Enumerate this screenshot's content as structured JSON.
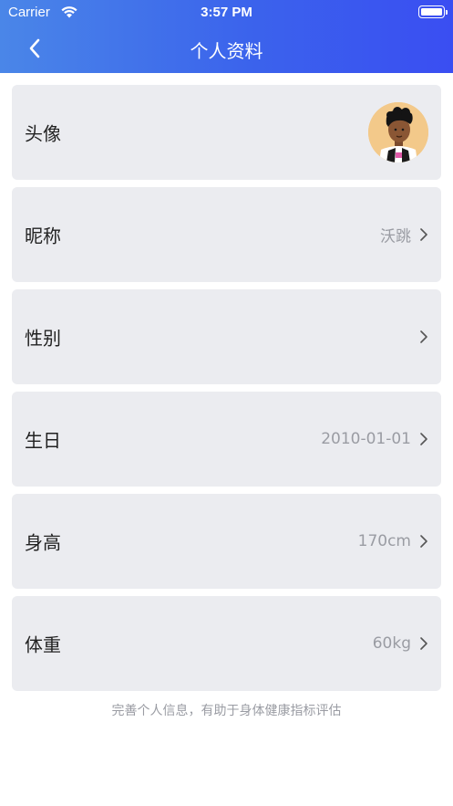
{
  "status_bar": {
    "carrier": "Carrier",
    "time": "3:57 PM"
  },
  "header": {
    "title": "个人资料",
    "back_icon": "chevron-left-icon"
  },
  "rows": [
    {
      "label": "头像",
      "value": "",
      "type": "avatar"
    },
    {
      "label": "昵称",
      "value": "沃跳"
    },
    {
      "label": "性别",
      "value": ""
    },
    {
      "label": "生日",
      "value": "2010-01-01"
    },
    {
      "label": "身高",
      "value": "170cm"
    },
    {
      "label": "体重",
      "value": "60kg"
    }
  ],
  "footer": {
    "tip": "完善个人信息，有助于身体健康指标评估"
  },
  "colors": {
    "header_start": "#4a86e8",
    "header_end": "#3a4ef2",
    "row_bg": "#ebecf0",
    "muted_text": "#9a9ca3"
  }
}
